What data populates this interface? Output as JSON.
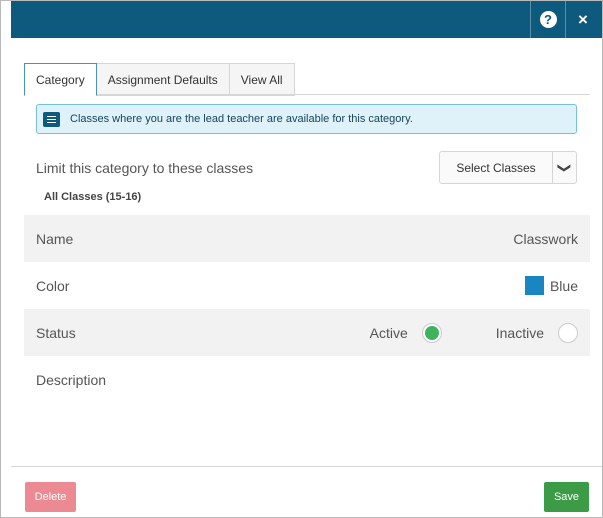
{
  "titlebar": {
    "help_icon": "?",
    "close_icon": "×"
  },
  "tabs": [
    {
      "label": "Category",
      "active": true
    },
    {
      "label": "Assignment Defaults",
      "active": false
    },
    {
      "label": "View All",
      "active": false
    }
  ],
  "info": {
    "text": "Classes where you are the lead teacher are available for this category.",
    "icon": "message-icon"
  },
  "limit": {
    "label": "Limit this category to these classes",
    "button_label": "Select Classes",
    "chevron": "❯",
    "all_classes": "All Classes  (15-16)"
  },
  "fields": {
    "name_label": "Name",
    "name_value": "Classwork",
    "color_label": "Color",
    "color_value": "Blue",
    "color_hex": "#1786c1",
    "status_label": "Status",
    "status_active": "Active",
    "status_inactive": "Inactive",
    "status_selected": "Active",
    "description_label": "Description"
  },
  "footer": {
    "delete_label": "Delete",
    "save_label": "Save"
  }
}
